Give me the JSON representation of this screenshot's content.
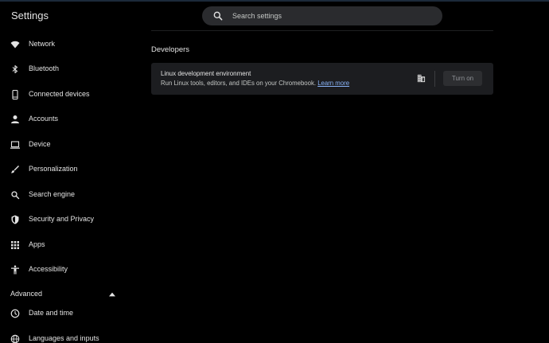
{
  "app": {
    "title": "Settings"
  },
  "search": {
    "placeholder": "Search settings"
  },
  "sidebar": {
    "items": [
      {
        "label": "Network",
        "icon": "wifi-icon"
      },
      {
        "label": "Bluetooth",
        "icon": "bluetooth-icon"
      },
      {
        "label": "Connected devices",
        "icon": "phone-icon"
      },
      {
        "label": "Accounts",
        "icon": "person-icon"
      },
      {
        "label": "Device",
        "icon": "laptop-icon"
      },
      {
        "label": "Personalization",
        "icon": "brush-icon"
      },
      {
        "label": "Search engine",
        "icon": "search-icon"
      },
      {
        "label": "Security and Privacy",
        "icon": "shield-icon"
      },
      {
        "label": "Apps",
        "icon": "apps-grid-icon"
      },
      {
        "label": "Accessibility",
        "icon": "accessibility-icon"
      }
    ],
    "advanced": {
      "label": "Advanced",
      "icon": "chevron-up-icon"
    },
    "advanced_items": [
      {
        "label": "Date and time",
        "icon": "clock-icon"
      },
      {
        "label": "Languages and inputs",
        "icon": "globe-icon"
      }
    ]
  },
  "main": {
    "section_title": "Developers",
    "card": {
      "title": "Linux development environment",
      "description": "Run Linux tools, editors, and IDEs on your Chromebook.",
      "link": "Learn more",
      "icon": "domain-icon",
      "button": "Turn on"
    }
  },
  "colors": {
    "background": "#000000",
    "card": "#1c1d20",
    "link": "#8ab4f8",
    "text": "#e3e3e3"
  }
}
